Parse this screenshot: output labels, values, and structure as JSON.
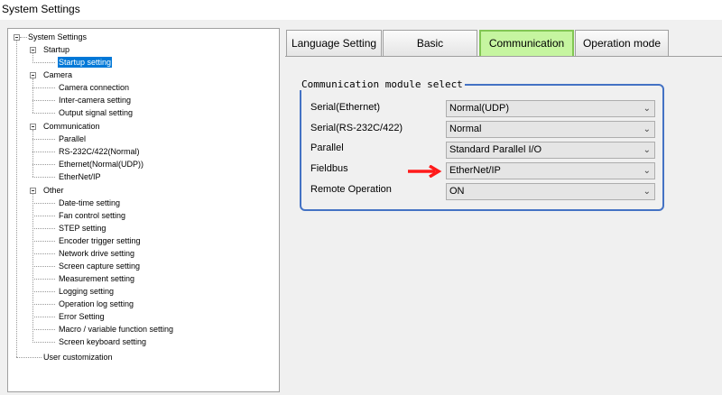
{
  "window": {
    "title": "System Settings"
  },
  "tree": {
    "root": "System Settings",
    "groups": [
      {
        "label": "Startup",
        "items": [
          "Startup setting"
        ]
      },
      {
        "label": "Camera",
        "items": [
          "Camera connection",
          "Inter-camera setting",
          "Output signal setting"
        ]
      },
      {
        "label": "Communication",
        "items": [
          "Parallel",
          "RS-232C/422(Normal)",
          "Ethernet(Normal(UDP))",
          "EtherNet/IP"
        ]
      },
      {
        "label": "Other",
        "items": [
          "Date-time setting",
          "Fan control setting",
          "STEP setting",
          "Encoder trigger setting",
          "Network drive setting",
          "Screen capture setting",
          "Measurement setting",
          "Logging setting",
          "Operation log setting",
          "Error Setting",
          "Macro / variable function setting",
          "Screen keyboard setting"
        ]
      }
    ],
    "extra": "User customization",
    "selected": "Startup setting"
  },
  "tabs": [
    {
      "label": "Language Setting",
      "active": false
    },
    {
      "label": "Basic",
      "active": false
    },
    {
      "label": "Communication",
      "active": true
    },
    {
      "label": "Operation mode",
      "active": false
    }
  ],
  "group": {
    "title": "Communication module select",
    "rows": [
      {
        "label": "Serial(Ethernet)",
        "value": "Normal(UDP)"
      },
      {
        "label": "Serial(RS-232C/422)",
        "value": "Normal"
      },
      {
        "label": "Parallel",
        "value": "Standard Parallel I/O"
      },
      {
        "label": "Fieldbus",
        "value": "EtherNet/IP"
      },
      {
        "label": "Remote Operation",
        "value": "ON"
      }
    ]
  },
  "colors": {
    "active_tab_bg": "#c6f5a0",
    "active_tab_border": "#82c653",
    "groupbox_border": "#4472c4",
    "selection": "#0078d7",
    "annotation_arrow": "#ff1a1a"
  },
  "icons": {
    "dropdown": "chevron-down-icon",
    "collapse": "minus-box-icon",
    "annotation": "red-arrow-icon"
  }
}
